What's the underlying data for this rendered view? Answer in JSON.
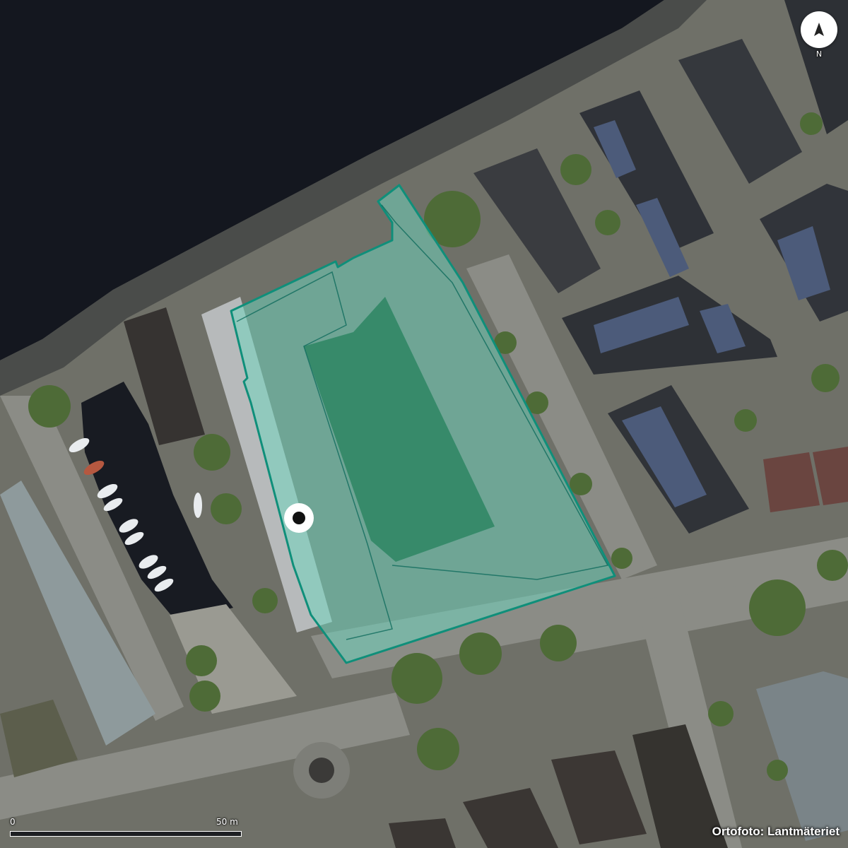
{
  "map": {
    "compass_label": "N",
    "scale": {
      "start": "0",
      "end": "50 m"
    },
    "attribution": "Ortofoto: Lantmäteriet",
    "colors": {
      "water": "#14171f",
      "parcel_fill": "#6fd6bf",
      "parcel_stroke": "#0f8f7a",
      "courtyard": "#2f7f5e",
      "pin": "#111111"
    }
  }
}
